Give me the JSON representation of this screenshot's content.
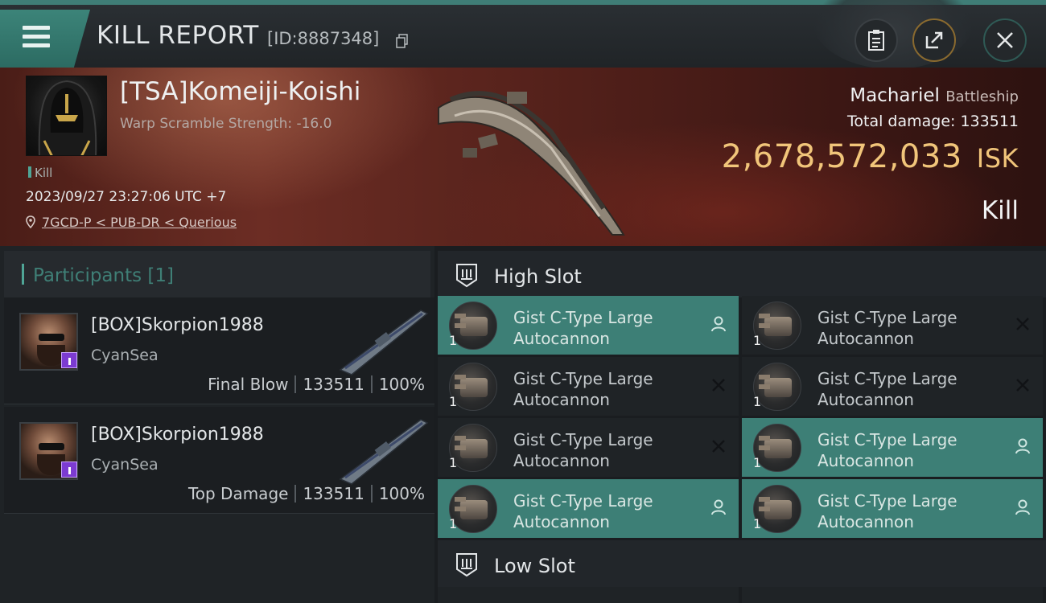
{
  "header": {
    "title": "KILL REPORT",
    "report_id": "[ID:8887348]"
  },
  "victim": {
    "name": "[TSA]Komeiji-Koishi",
    "subtitle": "Warp Scramble Strength: -16.0",
    "tag": "Kill",
    "time": "2023/09/27 23:27:06 UTC +7",
    "location": "7GCD-P < PUB-DR < Querious",
    "ship_name": "Machariel",
    "ship_class": "Battleship",
    "total_damage_label": "Total damage:",
    "total_damage": "133511",
    "isk_value": "2,678,572,033",
    "isk_unit": "ISK",
    "result": "Kill"
  },
  "participants": {
    "label": "Participants",
    "count": "[1]",
    "items": [
      {
        "name": "[BOX]Skorpion1988",
        "corp": "CyanSea",
        "role": "Final Blow",
        "damage": "133511",
        "percent": "100%"
      },
      {
        "name": "[BOX]Skorpion1988",
        "corp": "CyanSea",
        "role": "Top Damage",
        "damage": "133511",
        "percent": "100%"
      }
    ]
  },
  "slots": {
    "high_label": "High Slot",
    "low_label": "Low Slot",
    "high_modules": [
      {
        "name": "Gist C-Type Large Autocannon",
        "qty": "1",
        "status": "dropped"
      },
      {
        "name": "Gist C-Type Large Autocannon",
        "qty": "1",
        "status": "destroyed"
      },
      {
        "name": "Gist C-Type Large Autocannon",
        "qty": "1",
        "status": "destroyed"
      },
      {
        "name": "Gist C-Type Large Autocannon",
        "qty": "1",
        "status": "destroyed"
      },
      {
        "name": "Gist C-Type Large Autocannon",
        "qty": "1",
        "status": "destroyed"
      },
      {
        "name": "Gist C-Type Large Autocannon",
        "qty": "1",
        "status": "dropped"
      },
      {
        "name": "Gist C-Type Large Autocannon",
        "qty": "1",
        "status": "dropped"
      },
      {
        "name": "Gist C-Type Large Autocannon",
        "qty": "1",
        "status": "dropped"
      }
    ]
  },
  "colors": {
    "accent": "#3d7f76",
    "isk": "#f1c57a",
    "banner": "#5a231c",
    "badge": "#7c3bd1"
  },
  "icons": [
    "menu-icon",
    "copy-icon",
    "clipboard-icon",
    "share-icon",
    "close-icon",
    "location-pin-icon",
    "slot-icon",
    "person-icon",
    "x-icon"
  ]
}
